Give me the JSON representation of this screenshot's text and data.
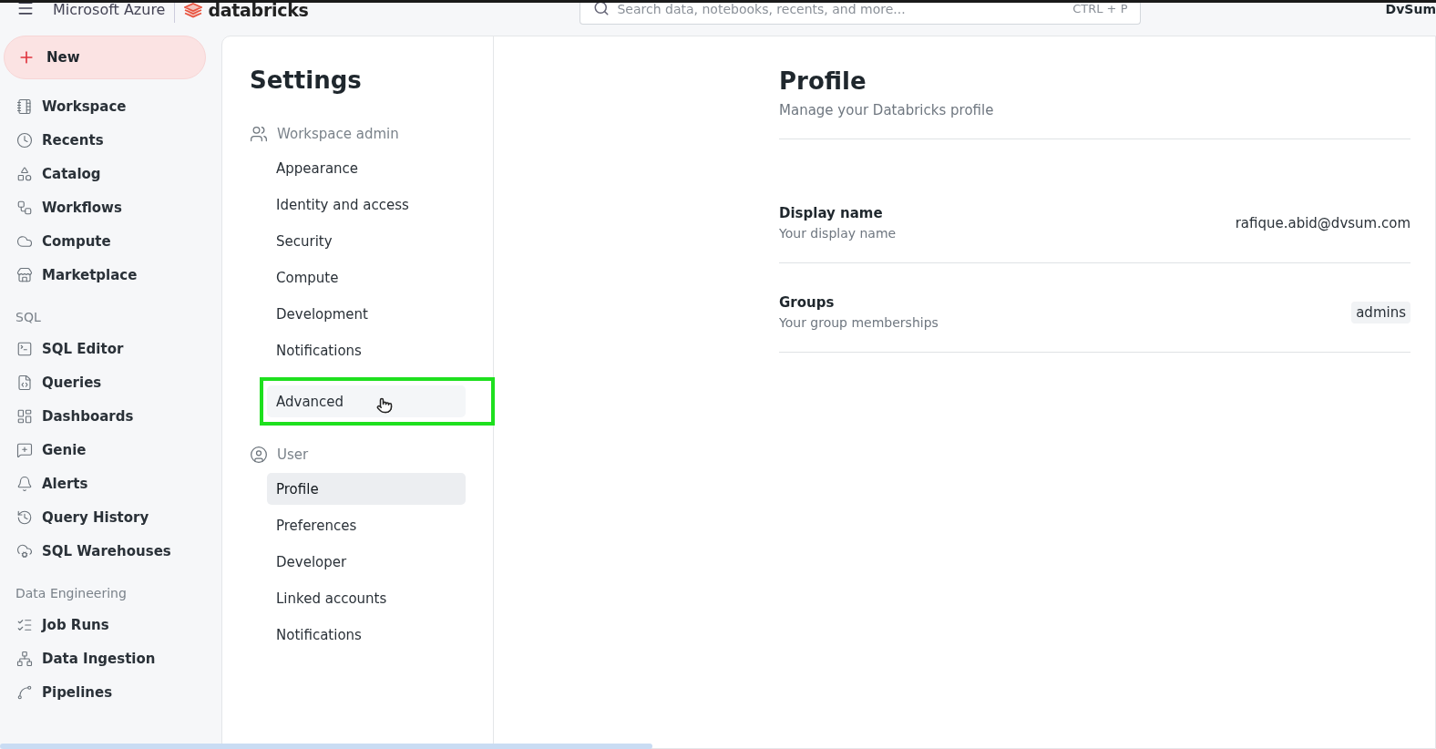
{
  "topbar": {
    "cloud": "Microsoft Azure",
    "brand": "databricks",
    "search": {
      "placeholder": "Search data, notebooks, recents, and more...",
      "shortcut": "CTRL + P"
    },
    "workspace": "DvSum"
  },
  "sidebar": {
    "new_button": "New",
    "sections": [
      {
        "items": [
          "Workspace",
          "Recents",
          "Catalog",
          "Workflows",
          "Compute",
          "Marketplace"
        ]
      },
      {
        "heading": "SQL",
        "items": [
          "SQL Editor",
          "Queries",
          "Dashboards",
          "Genie",
          "Alerts",
          "Query History",
          "SQL Warehouses"
        ]
      },
      {
        "heading": "Data Engineering",
        "items": [
          "Job Runs",
          "Data Ingestion",
          "Pipelines"
        ]
      }
    ]
  },
  "settings": {
    "title": "Settings",
    "groups": [
      {
        "label": "Workspace admin",
        "items": [
          {
            "label": "Appearance",
            "selected": false,
            "hovered": false
          },
          {
            "label": "Identity and access",
            "selected": false,
            "hovered": false
          },
          {
            "label": "Security",
            "selected": false,
            "hovered": false
          },
          {
            "label": "Compute",
            "selected": false,
            "hovered": false
          },
          {
            "label": "Development",
            "selected": false,
            "hovered": false
          },
          {
            "label": "Notifications",
            "selected": false,
            "hovered": false
          },
          {
            "label": "Advanced",
            "selected": false,
            "hovered": true
          }
        ]
      },
      {
        "label": "User",
        "items": [
          {
            "label": "Profile",
            "selected": true,
            "hovered": false
          },
          {
            "label": "Preferences",
            "selected": false,
            "hovered": false
          },
          {
            "label": "Developer",
            "selected": false,
            "hovered": false
          },
          {
            "label": "Linked accounts",
            "selected": false,
            "hovered": false
          },
          {
            "label": "Notifications",
            "selected": false,
            "hovered": false
          }
        ]
      }
    ]
  },
  "profile": {
    "title": "Profile",
    "subtitle": "Manage your Databricks profile",
    "rows": [
      {
        "kind": "text",
        "label": "Display name",
        "description": "Your display name",
        "value": "rafique.abid@dvsum.com"
      },
      {
        "kind": "tag",
        "label": "Groups",
        "description": "Your group memberships",
        "value": "admins"
      }
    ]
  }
}
